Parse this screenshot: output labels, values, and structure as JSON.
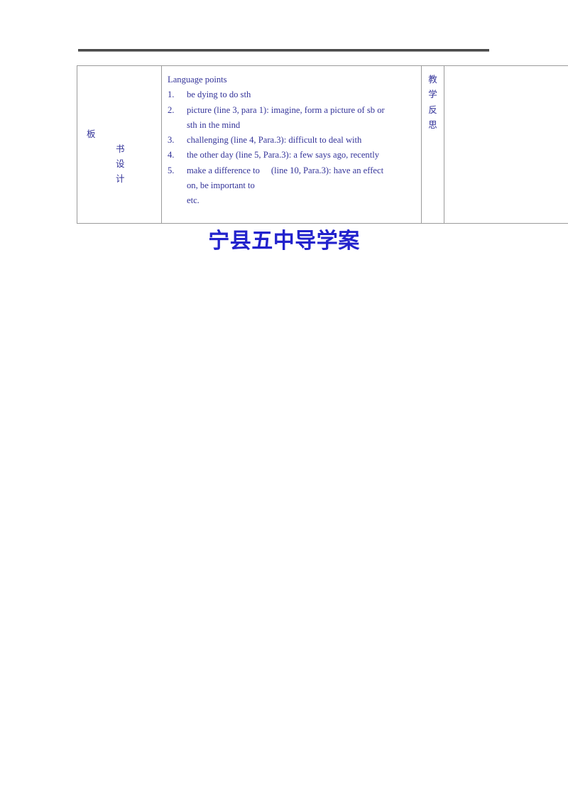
{
  "document": {
    "title_heading": "宁县五中导学案",
    "top_rule": "horizontal-rule"
  },
  "table": {
    "label_column": {
      "primary_char": "板",
      "stacked_chars": [
        "书",
        "设",
        "计"
      ]
    },
    "content_column": {
      "heading": "Language points",
      "items": [
        {
          "number": "1.",
          "lines": [
            "be dying to do sth"
          ]
        },
        {
          "number": "2.",
          "lines": [
            "picture (line 3, para 1): imagine, form a picture of sb or",
            "sth in the mind"
          ]
        },
        {
          "number": "3.",
          "lines": [
            "challenging (line 4, Para.3): difficult to deal with"
          ]
        },
        {
          "number": "4.",
          "lines": [
            "the other day (line 5, Para.3): a few says ago, recently"
          ]
        },
        {
          "number": "5.",
          "lines": [
            "make a difference to",
            "(line 10, Para.3): have an effect",
            "on, be important to"
          ]
        }
      ],
      "trailing_text": "etc."
    },
    "reflection_column": {
      "chars": [
        "教",
        "学",
        "反",
        "思"
      ]
    },
    "blank_column": {
      "content": ""
    }
  },
  "colors": {
    "body_text": "#333399",
    "title_text": "#2222cc",
    "table_border": "#9b9b9b",
    "rule": "#4a4a4a"
  }
}
